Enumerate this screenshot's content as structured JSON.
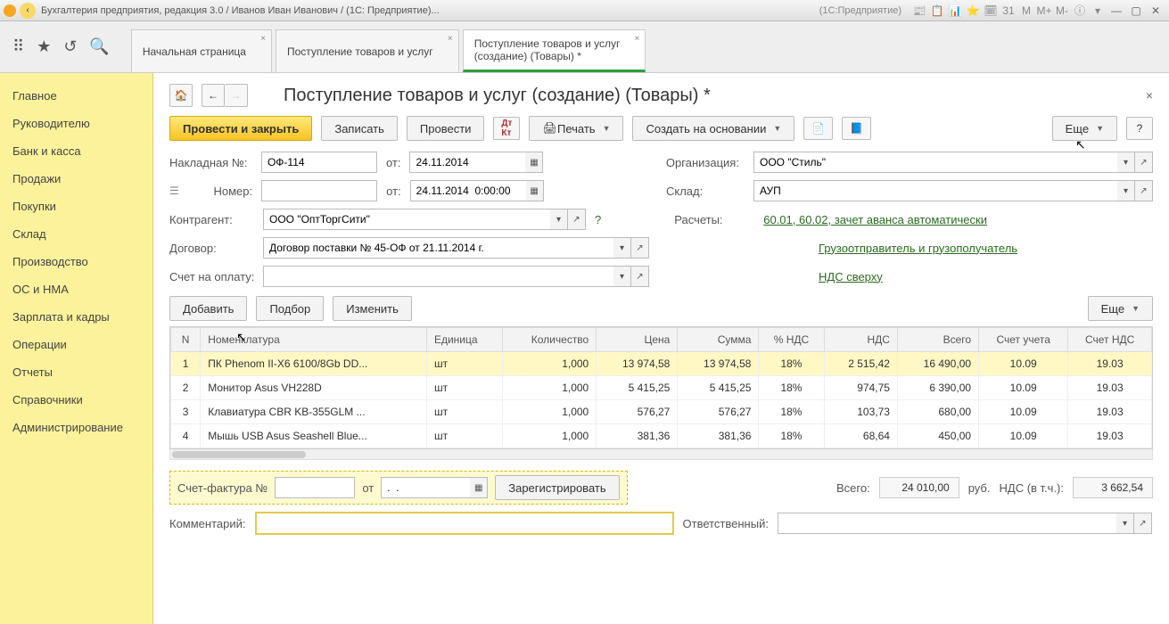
{
  "titlebar": {
    "title": "Бухгалтерия предприятия, редакция 3.0 / Иванов Иван Иванович / (1С: Предприятие)...",
    "meta": "(1С:Предприятие)",
    "icons": [
      "📰",
      "📋",
      "📊",
      "⭐",
      "🗓",
      "31",
      "M",
      "M+",
      "M-",
      "ⓘ"
    ]
  },
  "topbar": {
    "icons": [
      "⠿",
      "★",
      "↺",
      "🔍"
    ]
  },
  "tabs": [
    {
      "label": "Начальная страница",
      "sub": ""
    },
    {
      "label": "Поступление товаров и услуг",
      "sub": ""
    },
    {
      "label": "Поступление товаров и услуг",
      "sub": "(создание) (Товары) *",
      "active": true
    }
  ],
  "sidebar": [
    "Главное",
    "Руководителю",
    "Банк и касса",
    "Продажи",
    "Покупки",
    "Склад",
    "Производство",
    "ОС и НМА",
    "Зарплата и кадры",
    "Операции",
    "Отчеты",
    "Справочники",
    "Администрирование"
  ],
  "page": {
    "title": "Поступление товаров и услуг (создание) (Товары) *",
    "home_icon": "🏠",
    "back_icon": "←",
    "fwd_icon": "→",
    "close": "×"
  },
  "toolbar": {
    "main_btn": "Провести и закрыть",
    "write": "Записать",
    "post": "Провести",
    "print": "Печать",
    "create_on": "Создать на основании",
    "more": "Еще",
    "help": "?"
  },
  "form": {
    "invoice_lbl": "Накладная №:",
    "invoice": "ОФ-114",
    "from_lbl": "от:",
    "date1": "24.11.2014",
    "date2": "24.11.2014  0:00:00",
    "number_lbl": "Номер:",
    "number": "",
    "org_lbl": "Организация:",
    "org": "ООО \"Стиль\"",
    "wh_lbl": "Склад:",
    "wh": "АУП",
    "contr_lbl": "Контрагент:",
    "contr": "ООО \"ОптТоргСити\"",
    "calc_lbl": "Расчеты:",
    "calc_link": "60.01, 60.02, зачет аванса автоматически",
    "dog_lbl": "Договор:",
    "dog": "Договор поставки № 45-ОФ от 21.11.2014 г.",
    "ship_link": "Грузоотправитель и грузополучатель",
    "inv_lbl": "Счет на оплату:",
    "inv": "",
    "vat_link": "НДС сверху",
    "add_btn": "Добавить",
    "pick_btn": "Подбор",
    "edit_btn": "Изменить",
    "more2": "Еще"
  },
  "table": {
    "headers": [
      "N",
      "Номенклатура",
      "Единица",
      "Количество",
      "Цена",
      "Сумма",
      "% НДС",
      "НДС",
      "Всего",
      "Счет учета",
      "Счет НДС"
    ],
    "rows": [
      {
        "n": "1",
        "name": "ПК Phenom II-X6 6100/8Gb DD...",
        "unit": "шт",
        "qty": "1,000",
        "price": "13 974,58",
        "sum": "13 974,58",
        "vat_p": "18%",
        "vat": "2 515,42",
        "total": "16 490,00",
        "acct": "10.09",
        "vat_acct": "19.03"
      },
      {
        "n": "2",
        "name": "Монитор Asus VH228D",
        "unit": "шт",
        "qty": "1,000",
        "price": "5 415,25",
        "sum": "5 415,25",
        "vat_p": "18%",
        "vat": "974,75",
        "total": "6 390,00",
        "acct": "10.09",
        "vat_acct": "19.03"
      },
      {
        "n": "3",
        "name": "Клавиатура CBR KB-355GLM ...",
        "unit": "шт",
        "qty": "1,000",
        "price": "576,27",
        "sum": "576,27",
        "vat_p": "18%",
        "vat": "103,73",
        "total": "680,00",
        "acct": "10.09",
        "vat_acct": "19.03"
      },
      {
        "n": "4",
        "name": "Мышь USB Asus Seashell Blue...",
        "unit": "шт",
        "qty": "1,000",
        "price": "381,36",
        "sum": "381,36",
        "vat_p": "18%",
        "vat": "68,64",
        "total": "450,00",
        "acct": "10.09",
        "vat_acct": "19.03"
      }
    ]
  },
  "footer": {
    "sf_lbl": "Счет-фактура №",
    "sf_no": "",
    "sf_from": "от",
    "sf_date": ".  .",
    "sf_reg": "Зарегистрировать",
    "total_lbl": "Всего:",
    "total": "24 010,00",
    "rub": "руб.",
    "vat_lbl": "НДС (в т.ч.):",
    "vat": "3 662,54",
    "comment_lbl": "Комментарий:",
    "comment": "",
    "resp_lbl": "Ответственный:",
    "resp": ""
  }
}
